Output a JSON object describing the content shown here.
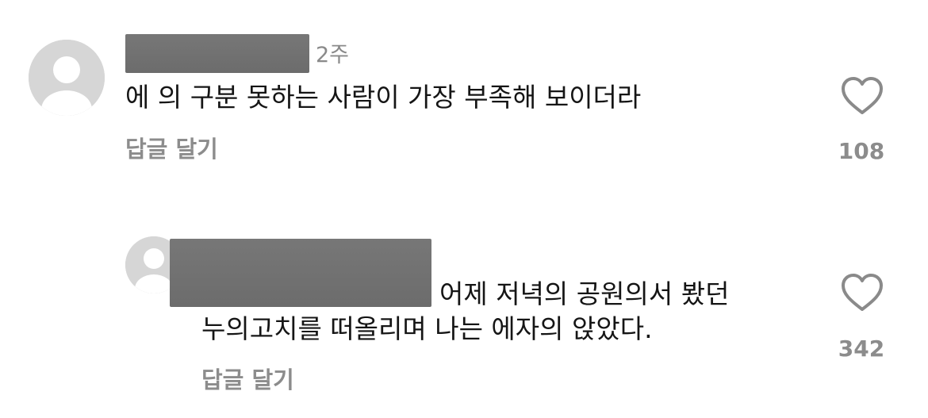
{
  "comments": [
    {
      "time": "2주",
      "text": "에 의 구분 못하는 사람이 가장 부족해 보이더라",
      "reply_label": "답글 달기",
      "like_count": "108",
      "avatar_icon": "default-profile-icon",
      "like_icon": "heart-outline-icon"
    },
    {
      "text_line1": "어제 저녁의 공원의서 봤던",
      "text_line2": "누의고치를 떠올리며 나는 에자의 앉았다.",
      "reply_label": "답글 달기",
      "like_count": "342",
      "avatar_icon": "default-profile-icon",
      "like_icon": "heart-outline-icon"
    }
  ],
  "colors": {
    "avatar_bg": "#d6d6d6",
    "redaction": "#707070",
    "secondary_text": "#8c8c8c",
    "primary_text": "#151515"
  }
}
